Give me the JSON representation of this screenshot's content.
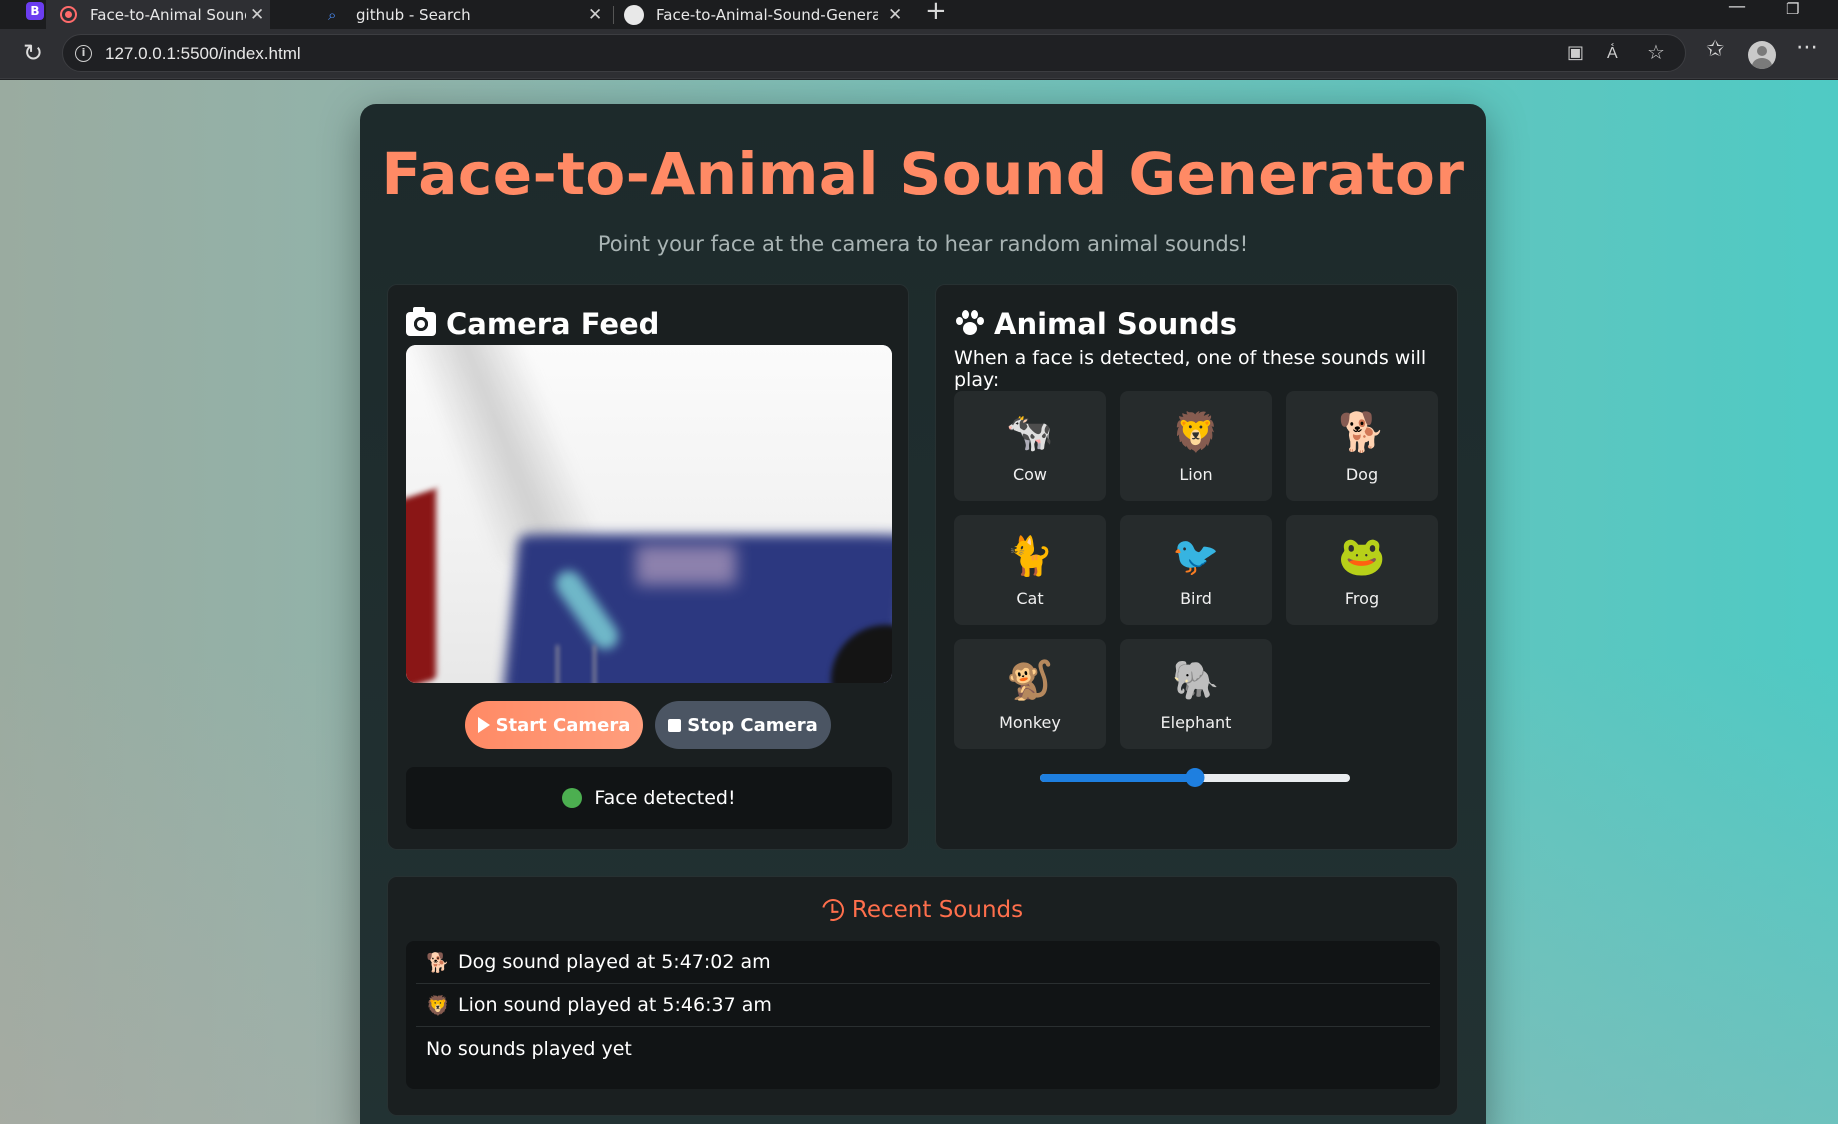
{
  "browser": {
    "tabs": [
      {
        "title": "Face-to-Animal Sound Generator",
        "active": true
      },
      {
        "title": "github - Search",
        "active": false
      },
      {
        "title": "Face-to-Animal-Sound-Generator",
        "active": false
      }
    ],
    "url": "127.0.0.1:5500/index.html",
    "profile_letter": "B"
  },
  "app": {
    "title": "Face-to-Animal Sound Generator",
    "subtitle": "Point your face at the camera to hear random animal sounds!",
    "accent_color": "#ff8a65"
  },
  "camera": {
    "heading": "Camera Feed",
    "start_label": "Start Camera",
    "stop_label": "Stop Camera",
    "status_text": "Face detected!",
    "status_color": "#4caf50"
  },
  "sounds": {
    "heading": "Animal Sounds",
    "instruction": "When a face is detected, one of these sounds will play:",
    "animals": [
      {
        "name": "Cow",
        "emoji": "🐄"
      },
      {
        "name": "Lion",
        "emoji": "🦁"
      },
      {
        "name": "Dog",
        "emoji": "🐕"
      },
      {
        "name": "Cat",
        "emoji": "🐈"
      },
      {
        "name": "Bird",
        "emoji": "🐦"
      },
      {
        "name": "Frog",
        "emoji": "🐸"
      },
      {
        "name": "Monkey",
        "emoji": "🐒"
      },
      {
        "name": "Elephant",
        "emoji": "🐘"
      }
    ],
    "volume": 0.5
  },
  "history": {
    "heading": "Recent Sounds",
    "entries": [
      {
        "emoji": "🐕",
        "text": "Dog sound played at 5:47:02 am"
      },
      {
        "emoji": "🦁",
        "text": "Lion sound played at 5:46:37 am"
      },
      {
        "emoji": "",
        "text": "No sounds played yet"
      }
    ]
  }
}
